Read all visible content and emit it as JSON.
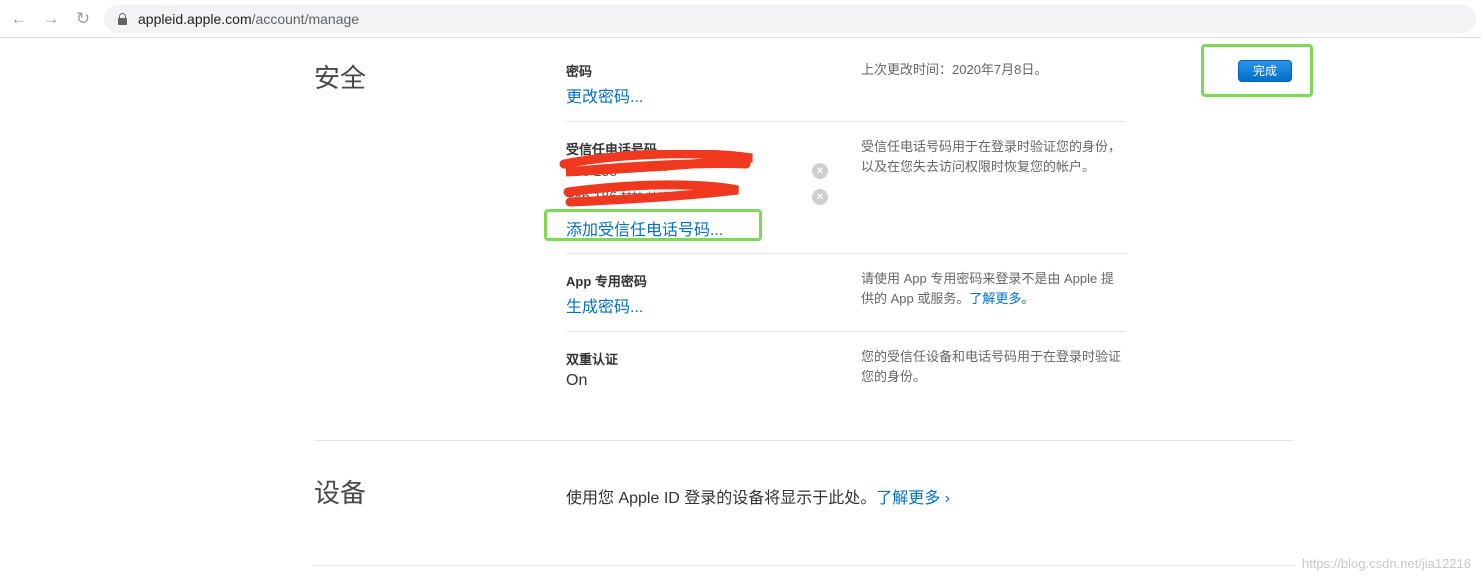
{
  "browser": {
    "url_host": "appleid.apple.com",
    "url_path": "/account/manage"
  },
  "security": {
    "title": "安全",
    "done_label": "完成",
    "password": {
      "label": "密码",
      "link": "更改密码...",
      "desc": "上次更改时间：2020年7月8日。"
    },
    "trusted_phone": {
      "label": "受信任电话号码",
      "phones": [
        "+86 138 **** ****",
        "+86 186 **** ****"
      ],
      "add_link": "添加受信任电话号码...",
      "desc": "受信任电话号码用于在登录时验证您的身份，以及在您失去访问权限时恢复您的帐户。"
    },
    "app_password": {
      "label": "App 专用密码",
      "link": "生成密码...",
      "desc_prefix": "请使用 App 专用密码来登录不是由 Apple 提供的 App 或服务。",
      "desc_link": "了解更多。"
    },
    "two_factor": {
      "label": "双重认证",
      "value": "On",
      "desc": "您的受信任设备和电话号码用于在登录时验证您的身份。"
    }
  },
  "devices": {
    "title": "设备",
    "text": "使用您 Apple ID 登录的设备将显示于此处。",
    "link": "了解更多",
    "chevron": "›"
  },
  "watermark": "https://blog.csdn.net/jia12216",
  "colors": {
    "link": "#0070c9",
    "highlight": "#7ed957",
    "redaction": "#f0381f"
  },
  "icons": {
    "back": "arrow-left-icon",
    "forward": "arrow-right-icon",
    "reload": "reload-icon",
    "lock": "lock-icon",
    "remove": "remove-circle-icon"
  }
}
